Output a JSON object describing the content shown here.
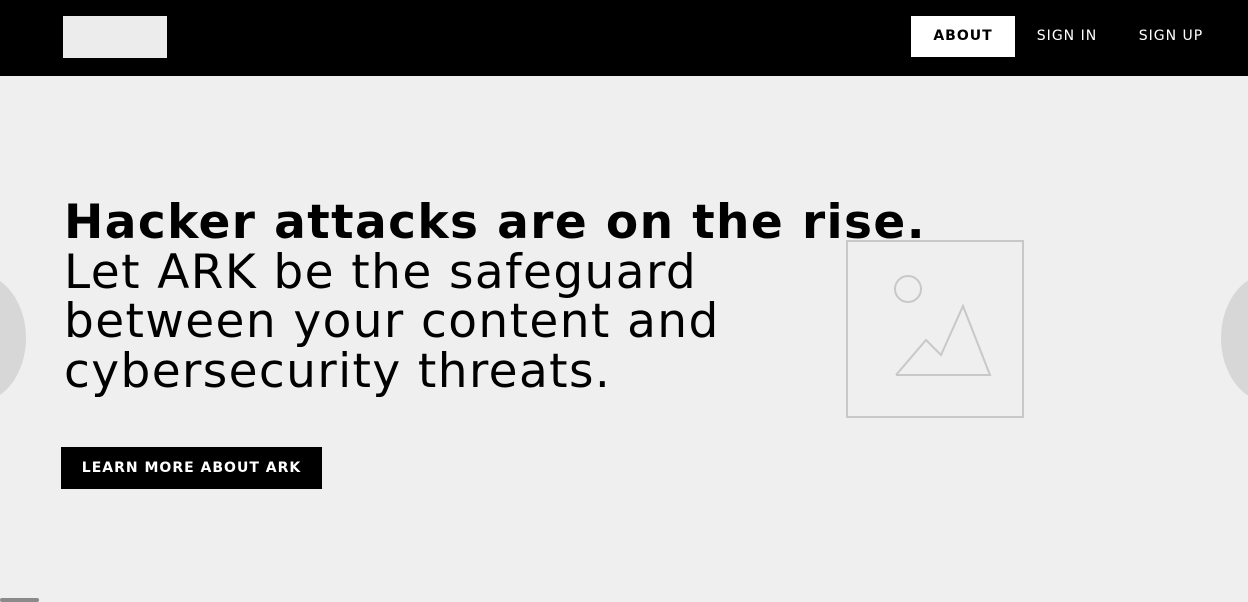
{
  "nav": {
    "about_label": "ABOUT",
    "signin_label": "SIGN IN",
    "signup_label": "SIGN UP"
  },
  "hero": {
    "headline": "Hacker attacks are on the rise.",
    "body": "Let ARK be the safeguard between your content and cybersecurity threats.",
    "cta_label": "LEARN MORE ABOUT ARK"
  },
  "icons": {
    "hero_image": "image-placeholder-icon",
    "carousel_prev": "carousel-prev-arrow",
    "carousel_next": "carousel-next-arrow"
  },
  "colors": {
    "nav_background": "#000000",
    "page_background": "#efefef",
    "primary_button": "#000000",
    "active_nav_background": "#ffffff"
  }
}
